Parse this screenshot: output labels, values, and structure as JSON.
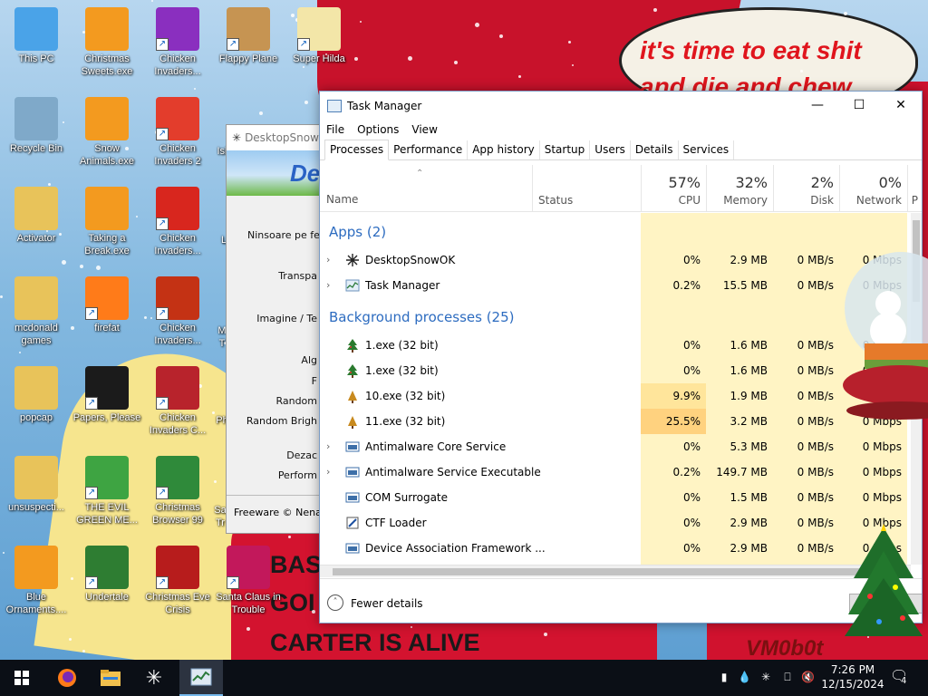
{
  "wallpaper": {
    "speech_bubble": "it's time to eat shit and die and chew",
    "poster_lines": [
      "BAS",
      "GOI",
      "CARTER IS ALIVE"
    ],
    "signature": "VM0b0t"
  },
  "desktop_icons": [
    {
      "label": "This PC",
      "icon": "this-pc-icon",
      "shortcut": false,
      "color": "#4aa3e8"
    },
    {
      "label": "Christmas Sweets.exe",
      "icon": "christmas-sweets-icon",
      "shortcut": false,
      "color": "#f39a1f"
    },
    {
      "label": "Chicken Invaders...",
      "icon": "chicken-invaders-icon",
      "shortcut": true,
      "color": "#8a2fbf"
    },
    {
      "label": "Flappy Plane",
      "icon": "flappy-plane-icon",
      "shortcut": true,
      "color": "#c69452"
    },
    {
      "label": "Super Hilda",
      "icon": "super-hilda-icon",
      "shortcut": true,
      "color": "#f3e6a8"
    },
    {
      "label": "Recycle Bin",
      "icon": "recycle-bin-icon",
      "shortcut": false,
      "color": "#7fa9c9"
    },
    {
      "label": "Snow Animals.exe",
      "icon": "snow-animals-icon",
      "shortcut": false,
      "color": "#f39a1f"
    },
    {
      "label": "Chicken Invaders 2",
      "icon": "chicken-invaders-2-icon",
      "shortcut": true,
      "color": "#e33d2c"
    },
    {
      "label": "Activator",
      "icon": "folder-icon",
      "shortcut": false,
      "color": "#e8c35a"
    },
    {
      "label": "Taking a Break.exe",
      "icon": "taking-a-break-icon",
      "shortcut": false,
      "color": "#f39a1f"
    },
    {
      "label": "Chicken Invaders...",
      "icon": "chicken-invaders-3-icon",
      "shortcut": true,
      "color": "#d8261e"
    },
    {
      "label": "mcdonald games",
      "icon": "folder-icon",
      "shortcut": false,
      "color": "#e8c35a"
    },
    {
      "label": "firefat",
      "icon": "firefox-icon",
      "shortcut": true,
      "color": "#ff7b19"
    },
    {
      "label": "Chicken Invaders...",
      "icon": "chicken-invaders-4-icon",
      "shortcut": true,
      "color": "#c43214"
    },
    {
      "label": "popcap",
      "icon": "folder-icon",
      "shortcut": false,
      "color": "#e8c35a"
    },
    {
      "label": "Papers, Please",
      "icon": "papers-please-icon",
      "shortcut": true,
      "color": "#1b1b1b"
    },
    {
      "label": "Chicken Invaders C...",
      "icon": "chicken-invaders-5-icon",
      "shortcut": true,
      "color": "#b8232c"
    },
    {
      "label": "unsuspecti...",
      "icon": "folder-icon",
      "shortcut": false,
      "color": "#e8c35a"
    },
    {
      "label": "THE EVIL GREEN ME...",
      "icon": "msn-messenger-icon",
      "shortcut": true,
      "color": "#3ea442"
    },
    {
      "label": "Christmas Browser 99",
      "icon": "christmas-browser-icon",
      "shortcut": true,
      "color": "#2f8a3a"
    },
    {
      "label": "Blue Ornaments....",
      "icon": "blue-ornaments-icon",
      "shortcut": false,
      "color": "#f39a1f"
    },
    {
      "label": "Undertale",
      "icon": "undertale-icon",
      "shortcut": true,
      "color": "#2e7d32"
    },
    {
      "label": "Christmas Eve Crisis",
      "icon": "christmas-eve-crisis-icon",
      "shortcut": true,
      "color": "#b71c1c"
    },
    {
      "label": "Santa Claus in Trouble",
      "icon": "santa-claus-icon",
      "shortcut": true,
      "color": "#c2185b"
    }
  ],
  "partial_labels": {
    "fourth_col_1": "Isl",
    "fourth_col_2": "L",
    "fourth_col_3": "M",
    "fourth_col_4": "T",
    "fourth_col_5": "Ph",
    "fourth_col_6": "Sa",
    "fourth_col_7": "Tr"
  },
  "snow_window": {
    "title": "DesktopSnowO",
    "banner": "De",
    "lines": [
      "Ninsoare pe ferest",
      "Transpa",
      "Imagine / Te",
      "Alg",
      "F",
      "Random",
      "Random Brigh",
      "Dezac",
      "Perform"
    ],
    "footer": "Freeware © Nenad"
  },
  "task_manager": {
    "title": "Task Manager",
    "menu": [
      "File",
      "Options",
      "View"
    ],
    "tabs": [
      "Processes",
      "Performance",
      "App history",
      "Startup",
      "Users",
      "Details",
      "Services"
    ],
    "active_tab": "Processes",
    "columns": {
      "name": "Name",
      "status": "Status",
      "cpu": {
        "pct": "57%",
        "label": "CPU"
      },
      "memory": {
        "pct": "32%",
        "label": "Memory"
      },
      "disk": {
        "pct": "2%",
        "label": "Disk"
      },
      "network": {
        "pct": "0%",
        "label": "Network"
      },
      "power": "P"
    },
    "apps_group": "Apps (2)",
    "apps": [
      {
        "name": "DesktopSnowOK",
        "cpu": "0%",
        "mem": "2.9 MB",
        "disk": "0 MB/s",
        "net": "0 Mbps",
        "expand": true,
        "icon": "snowflake-icon"
      },
      {
        "name": "Task Manager",
        "cpu": "0.2%",
        "mem": "15.5 MB",
        "disk": "0 MB/s",
        "net": "0 Mbps",
        "expand": true,
        "icon": "task-manager-icon"
      }
    ],
    "bg_group": "Background processes (25)",
    "bg": [
      {
        "name": "1.exe (32 bit)",
        "cpu": "0%",
        "mem": "1.6 MB",
        "disk": "0 MB/s",
        "net": "0 Mbps",
        "expand": false,
        "icon": "xmas-tree-icon"
      },
      {
        "name": "1.exe (32 bit)",
        "cpu": "0%",
        "mem": "1.6 MB",
        "disk": "0 MB/s",
        "net": "0 Mbps",
        "expand": false,
        "icon": "xmas-tree-icon"
      },
      {
        "name": "10.exe (32 bit)",
        "cpu": "9.9%",
        "mem": "1.9 MB",
        "disk": "0 MB/s",
        "net": "0 Mbps",
        "expand": false,
        "icon": "xmas-tree-small-icon"
      },
      {
        "name": "11.exe (32 bit)",
        "cpu": "25.5%",
        "mem": "3.2 MB",
        "disk": "0 MB/s",
        "net": "0 Mbps",
        "expand": false,
        "icon": "xmas-tree-small-icon"
      },
      {
        "name": "Antimalware Core Service",
        "cpu": "0%",
        "mem": "5.3 MB",
        "disk": "0 MB/s",
        "net": "0 Mbps",
        "expand": true,
        "icon": "service-icon"
      },
      {
        "name": "Antimalware Service Executable",
        "cpu": "0.2%",
        "mem": "149.7 MB",
        "disk": "0 MB/s",
        "net": "0 Mbps",
        "expand": true,
        "icon": "service-icon"
      },
      {
        "name": "COM Surrogate",
        "cpu": "0%",
        "mem": "1.5 MB",
        "disk": "0 MB/s",
        "net": "0 Mbps",
        "expand": false,
        "icon": "service-icon"
      },
      {
        "name": "CTF Loader",
        "cpu": "0%",
        "mem": "2.9 MB",
        "disk": "0 MB/s",
        "net": "0 Mbps",
        "expand": false,
        "icon": "ctf-loader-icon"
      },
      {
        "name": "Device Association Framework ...",
        "cpu": "0%",
        "mem": "2.9 MB",
        "disk": "0 MB/s",
        "net": "0 Mbps",
        "expand": false,
        "icon": "service-icon"
      }
    ],
    "fewer_details": "Fewer details"
  },
  "taskbar": {
    "time": "7:26 PM",
    "date": "12/15/2024",
    "notification_count": "4",
    "apps": [
      "start-icon",
      "firefox-icon",
      "file-explorer-icon",
      "snowflake-icon",
      "task-manager-icon"
    ],
    "active_app": "task-manager-icon"
  },
  "colors": {
    "accent": "#2d6cc0",
    "cpu_heat_low": "#fff4c4",
    "cpu_heat_mid": "#ffe59b",
    "cpu_heat_high": "#ffd27f",
    "taskbar": "#0b0f16"
  }
}
